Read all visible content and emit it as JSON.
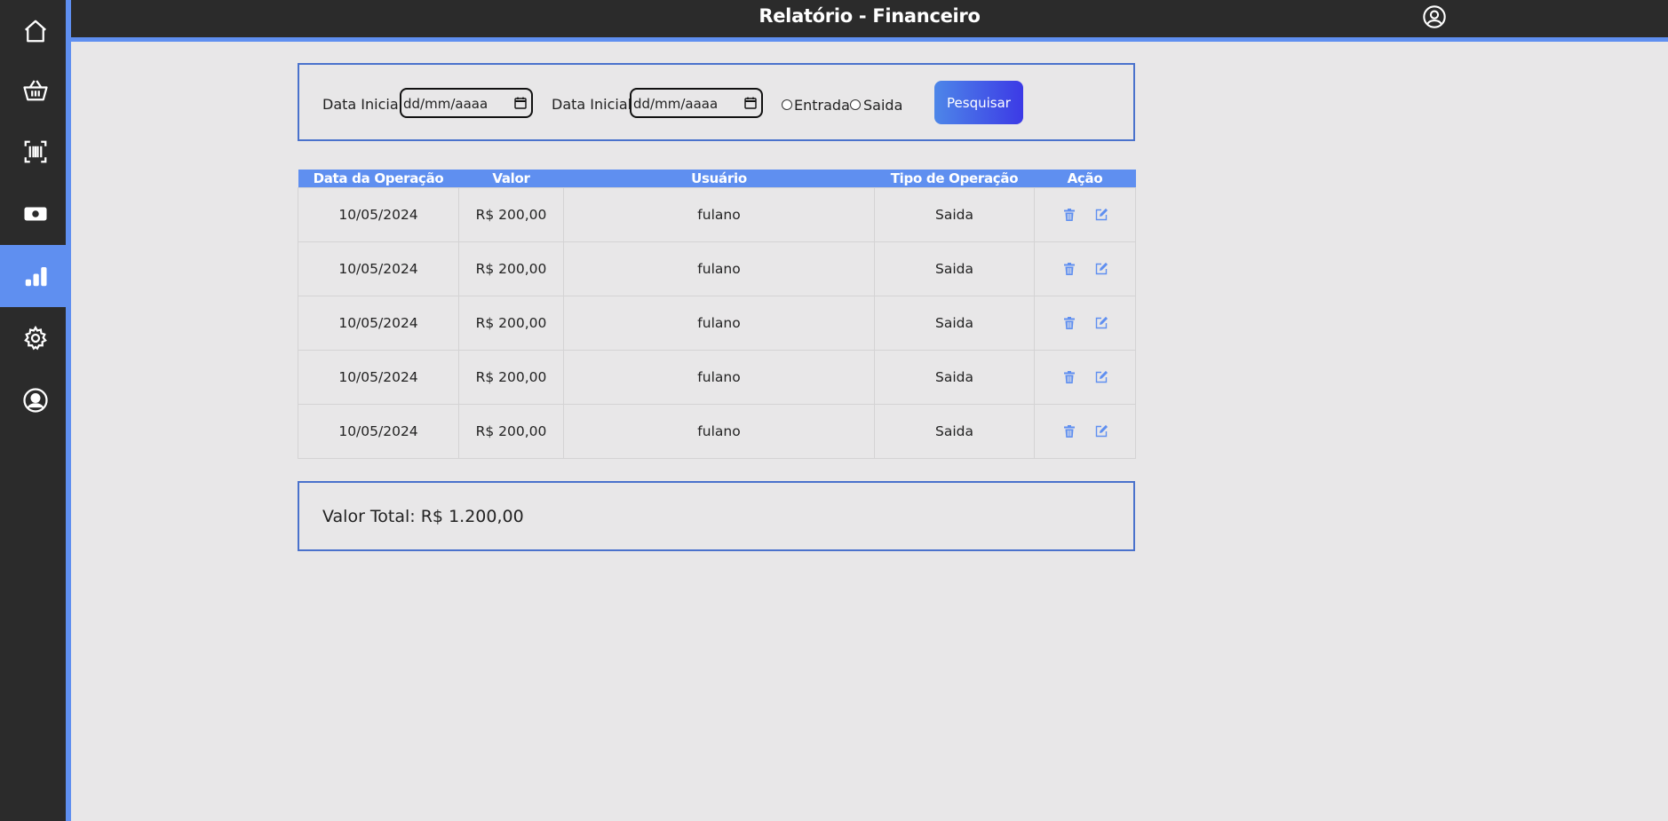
{
  "header": {
    "title": "Relatório - Financeiro"
  },
  "sidebar": {
    "items": [
      {
        "icon": "home-icon"
      },
      {
        "icon": "basket-icon"
      },
      {
        "icon": "barcode-scan-icon"
      },
      {
        "icon": "cash-icon"
      },
      {
        "icon": "bar-chart-icon",
        "active": true
      },
      {
        "icon": "gear-icon"
      },
      {
        "icon": "user-circle-icon"
      }
    ]
  },
  "filters": {
    "start_label": "Data Inicial:",
    "end_label": "Data Inicial:",
    "date_placeholder": "dd/mm/aaaa",
    "radio_options": [
      "Entrada",
      "Saida"
    ],
    "search_button": "Pesquisar"
  },
  "table": {
    "headers": [
      "Data da Operação",
      "Valor",
      "Usuário",
      "Tipo de Operação",
      "Ação"
    ],
    "rows": [
      [
        "10/05/2024",
        "R$ 200,00",
        "fulano",
        "Saida"
      ],
      [
        "10/05/2024",
        "R$ 200,00",
        "fulano",
        "Saida"
      ],
      [
        "10/05/2024",
        "R$ 200,00",
        "fulano",
        "Saida"
      ],
      [
        "10/05/2024",
        "R$ 200,00",
        "fulano",
        "Saida"
      ],
      [
        "10/05/2024",
        "R$ 200,00",
        "fulano",
        "Saida"
      ]
    ]
  },
  "summary": {
    "total": "Valor Total: R$ 1.200,00"
  },
  "colors": {
    "accent": "#5f8ff0",
    "sidebar_bg": "#2b2b2b",
    "page_bg": "#e8e7e8"
  }
}
